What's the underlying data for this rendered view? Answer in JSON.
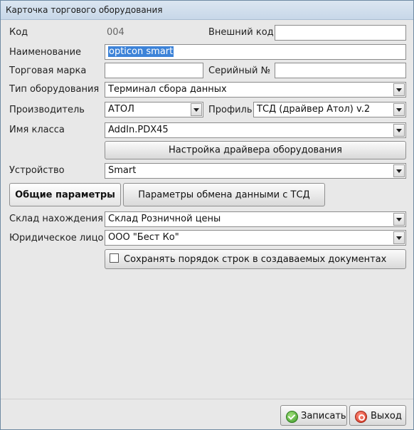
{
  "window": {
    "title": "Карточка торгового оборудования"
  },
  "form": {
    "code_label": "Код",
    "code_value": "004",
    "external_code_label": "Внешний код",
    "external_code_value": "",
    "name_label": "Наименование",
    "name_value": "opticon smart",
    "brand_label": "Торговая марка",
    "brand_value": "",
    "serial_label": "Серийный №",
    "serial_value": "",
    "equipment_type_label": "Тип оборудования",
    "equipment_type_value": "Терминал сбора данных",
    "manufacturer_label": "Производитель",
    "manufacturer_value": "АТОЛ",
    "profile_label": "Профиль",
    "profile_value": "ТСД (драйвер Атол) v.2",
    "class_name_label": "Имя класса",
    "class_name_value": "AddIn.PDX45",
    "driver_settings_button": "Настройка драйвера оборудования",
    "device_label": "Устройство",
    "device_value": "Smart"
  },
  "tabs": [
    {
      "label": "Общие параметры",
      "active": true
    },
    {
      "label": "Параметры обмена данными с ТСД",
      "active": false
    }
  ],
  "general": {
    "warehouse_label": "Склад нахождения",
    "warehouse_value": "Склад Розничной цены",
    "legal_entity_label": "Юридическое лицо",
    "legal_entity_value": "ООО \"Бест Ко\"",
    "keep_row_order_label": "Сохранять порядок строк в создаваемых документах",
    "keep_row_order_checked": false
  },
  "footer": {
    "save_label": "Записать",
    "exit_label": "Выход"
  },
  "colors": {
    "selection": "#3d83d8",
    "background": "#e8e8e8"
  }
}
